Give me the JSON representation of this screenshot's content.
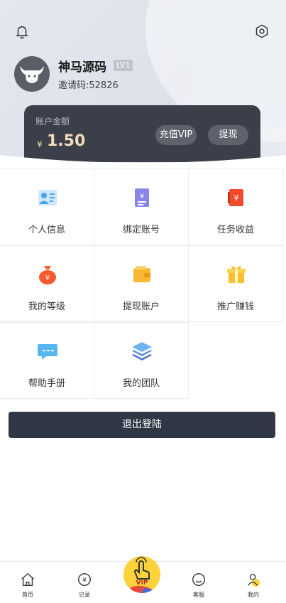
{
  "profile": {
    "username": "神马源码",
    "level": "LV1",
    "invite_code": "邀请码:52826"
  },
  "balance": {
    "label": "账户金额",
    "currency": "¥",
    "amount": "1.50",
    "vip_button": "充值VIP",
    "withdraw_button": "提现"
  },
  "menu": {
    "items": [
      {
        "label": "个人信息",
        "icon": "id-card-icon"
      },
      {
        "label": "绑定账号",
        "icon": "bind-account-icon"
      },
      {
        "label": "任务收益",
        "icon": "task-earnings-icon"
      },
      {
        "label": "我的等级",
        "icon": "money-bag-icon"
      },
      {
        "label": "提现账户",
        "icon": "wallet-icon"
      },
      {
        "label": "推广赚钱",
        "icon": "gift-icon"
      },
      {
        "label": "帮助手册",
        "icon": "chat-icon"
      },
      {
        "label": "我的团队",
        "icon": "layers-icon"
      }
    ]
  },
  "logout_label": "退出登陆",
  "tabbar": {
    "home": "首页",
    "records": "记录",
    "vip": "VIP",
    "service": "客服",
    "mine": "我的"
  },
  "colors": {
    "card_bg": "#3a3f4a",
    "balance_gold": "#f3dcb7",
    "logout_bg": "#303846",
    "vip_yellow": "#fcd33a"
  }
}
